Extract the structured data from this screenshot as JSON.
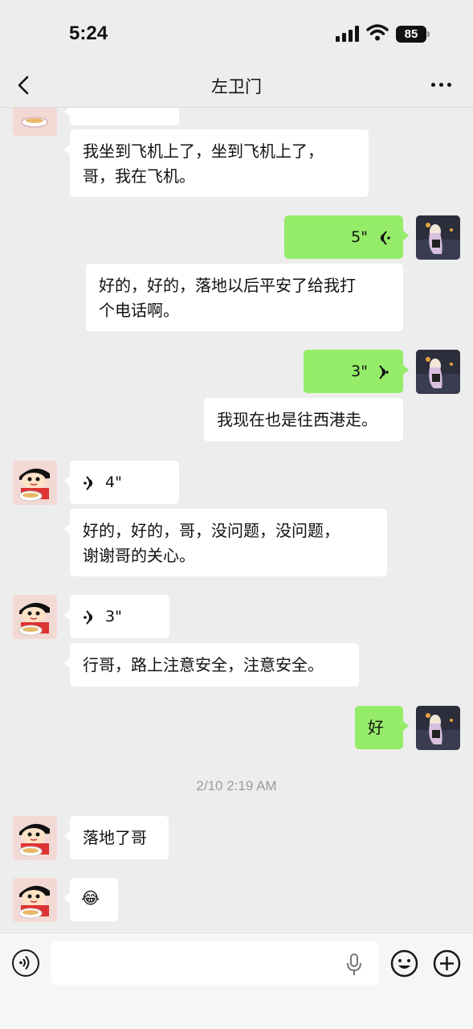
{
  "status_bar": {
    "time": "5:24",
    "battery": "85"
  },
  "header": {
    "title": "左卫门"
  },
  "messages": [
    {
      "text": "我坐到飞机上了，坐到飞机上了，\n哥，我在飞机。"
    },
    {
      "duration": "5\""
    },
    {
      "text": "好的，好的，落地以后平安了给我打\n个电话啊。"
    },
    {
      "duration": "3\""
    },
    {
      "text": "我现在也是往西港走。"
    },
    {
      "duration": "4\""
    },
    {
      "text": "好的，好的，哥，没问题，没问题，\n谢谢哥的关心。"
    },
    {
      "duration": "3\""
    },
    {
      "text": "行哥，路上注意安全，注意安全。"
    },
    {
      "text": "好"
    },
    {
      "text": "落地了哥"
    },
    {
      "text": "😂"
    }
  ],
  "timestamp": "2/10 2:19 AM",
  "colors": {
    "sent_bubble": "#95ec69",
    "received_bubble": "#ffffff",
    "background": "#ededed"
  }
}
